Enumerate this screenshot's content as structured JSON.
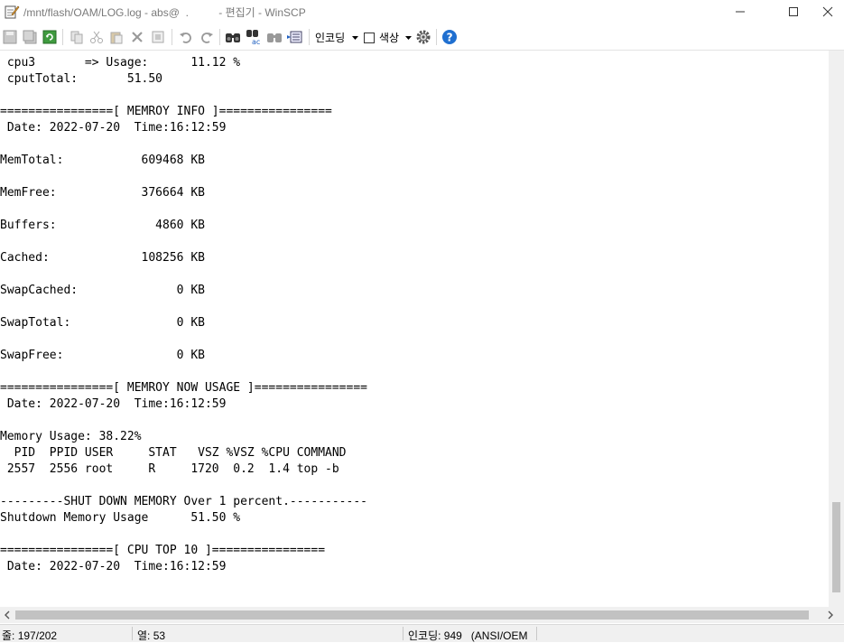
{
  "window": {
    "title": "/mnt/flash/OAM/LOG.log - abs@  .          - 편집기 - WinSCP"
  },
  "toolbar": {
    "encoding_label": "인코딩",
    "color_label": "색상",
    "icons": [
      "save-icon",
      "save-all-icon",
      "reload-icon",
      "copy-icon",
      "cut-icon",
      "paste-icon",
      "delete-icon",
      "select-all-icon",
      "undo-icon",
      "redo-icon",
      "find-icon",
      "replace-icon",
      "find-next-icon",
      "goto-line-icon",
      "encoding-dropdown-icon",
      "color-checkbox",
      "settings-icon",
      "help-icon"
    ]
  },
  "editor": {
    "lines": [
      " cpu3       => Usage:      11.12 %",
      " cputTotal:       51.50",
      "",
      "================[ MEMROY INFO ]================",
      " Date: 2022-07-20  Time:16:12:59",
      "",
      "MemTotal:           609468 KB",
      "",
      "MemFree:            376664 KB",
      "",
      "Buffers:              4860 KB",
      "",
      "Cached:             108256 KB",
      "",
      "SwapCached:              0 KB",
      "",
      "SwapTotal:               0 KB",
      "",
      "SwapFree:                0 KB",
      "",
      "================[ MEMROY NOW USAGE ]================",
      " Date: 2022-07-20  Time:16:12:59",
      "",
      "Memory Usage: 38.22%",
      "  PID  PPID USER     STAT   VSZ %VSZ %CPU COMMAND",
      " 2557  2556 root     R     1720  0.2  1.4 top -b",
      "",
      "---------SHUT DOWN MEMORY Over 1 percent.-----------",
      "Shutdown Memory Usage      51.50 %",
      "",
      "================[ CPU TOP 10 ]================",
      " Date: 2022-07-20  Time:16:12:59"
    ]
  },
  "status": {
    "line": "줄: 197/202",
    "column": "열: 53",
    "encoding": "인코딩: 949   (ANSI/OEM"
  }
}
